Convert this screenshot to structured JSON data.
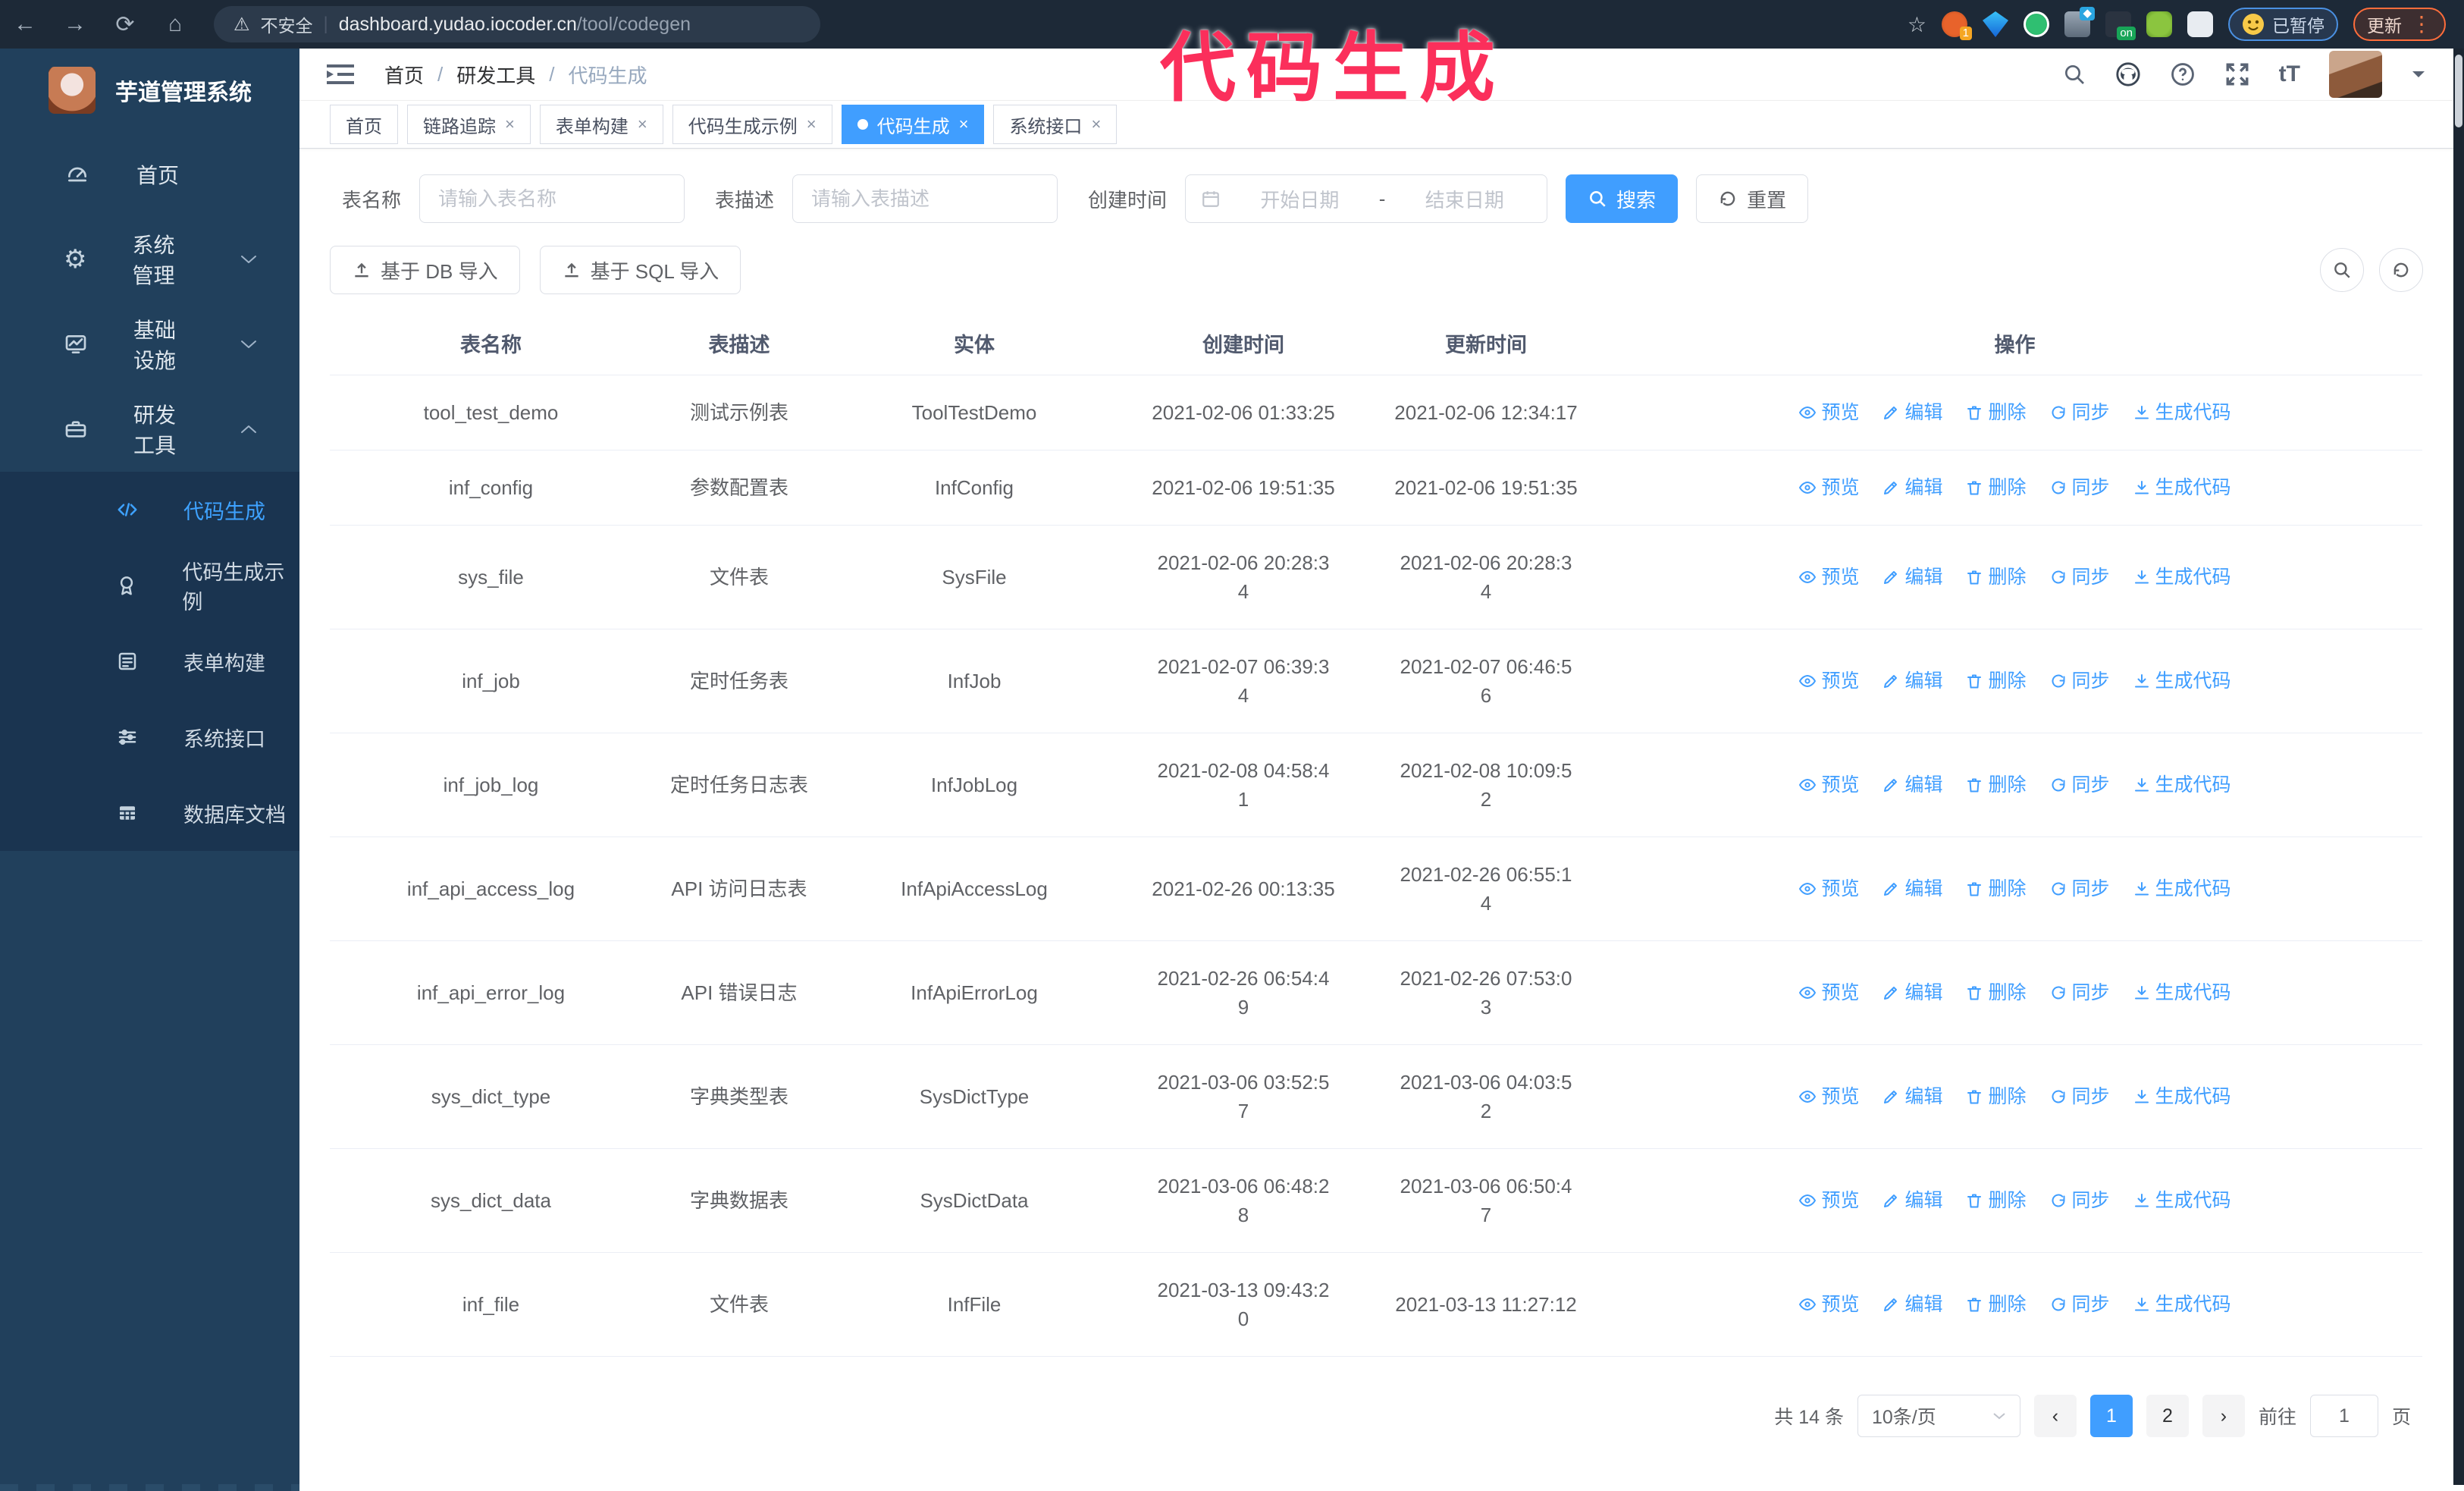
{
  "browser": {
    "security_warning": "不安全",
    "url_host": "dashboard.yudao.iocoder.cn",
    "url_path": "/tool/codegen",
    "paused_badge": "已暂停",
    "update_button": "更新"
  },
  "watermark": "代码生成",
  "colors": {
    "accent": "#409eff",
    "sidebar_bg": "#21405c",
    "submenu_bg": "#1a3450",
    "watermark_pink": "#fb2f5b"
  },
  "sidebar": {
    "title": "芋道管理系统",
    "items": [
      {
        "label": "首页",
        "icon": "dashboard-icon",
        "chevron": ""
      },
      {
        "label": "系统管理",
        "icon": "gear-icon",
        "chevron": "down"
      },
      {
        "label": "基础设施",
        "icon": "monitor-icon",
        "chevron": "down"
      },
      {
        "label": "研发工具",
        "icon": "toolbox-icon",
        "chevron": "up"
      }
    ],
    "submenu": [
      {
        "label": "代码生成",
        "icon": "code-icon",
        "active": true
      },
      {
        "label": "代码生成示例",
        "icon": "example-icon",
        "active": false
      },
      {
        "label": "表单构建",
        "icon": "form-icon",
        "active": false
      },
      {
        "label": "系统接口",
        "icon": "api-icon",
        "active": false
      },
      {
        "label": "数据库文档",
        "icon": "database-icon",
        "active": false
      }
    ]
  },
  "header": {
    "breadcrumb": [
      "首页",
      "研发工具",
      "代码生成"
    ]
  },
  "tabs": [
    {
      "label": "首页",
      "closable": false,
      "active": false
    },
    {
      "label": "链路追踪",
      "closable": true,
      "active": false
    },
    {
      "label": "表单构建",
      "closable": true,
      "active": false
    },
    {
      "label": "代码生成示例",
      "closable": true,
      "active": false
    },
    {
      "label": "代码生成",
      "closable": true,
      "active": true
    },
    {
      "label": "系统接口",
      "closable": true,
      "active": false
    }
  ],
  "filters": {
    "name_label": "表名称",
    "name_placeholder": "请输入表名称",
    "desc_label": "表描述",
    "desc_placeholder": "请输入表描述",
    "time_label": "创建时间",
    "start_placeholder": "开始日期",
    "range_separator": "-",
    "end_placeholder": "结束日期",
    "search_label": "搜索",
    "reset_label": "重置"
  },
  "toolbar": {
    "import_db_label": "基于 DB 导入",
    "import_sql_label": "基于 SQL 导入"
  },
  "table": {
    "columns": [
      "表名称",
      "表描述",
      "实体",
      "创建时间",
      "更新时间",
      "操作"
    ],
    "actions": [
      {
        "label": "预览",
        "icon": "eye-icon"
      },
      {
        "label": "编辑",
        "icon": "edit-icon"
      },
      {
        "label": "删除",
        "icon": "delete-icon"
      },
      {
        "label": "同步",
        "icon": "sync-icon"
      },
      {
        "label": "生成代码",
        "icon": "download-icon"
      }
    ],
    "rows": [
      {
        "name": "tool_test_demo",
        "desc": "测试示例表",
        "entity": "ToolTestDemo",
        "created": "2021-02-06 01:33:25",
        "updated": "2021-02-06 12:34:17"
      },
      {
        "name": "inf_config",
        "desc": "参数配置表",
        "entity": "InfConfig",
        "created": "2021-02-06 19:51:35",
        "updated": "2021-02-06 19:51:35"
      },
      {
        "name": "sys_file",
        "desc": "文件表",
        "entity": "SysFile",
        "created": "2021-02-06 20:28:3\n4",
        "updated": "2021-02-06 20:28:3\n4"
      },
      {
        "name": "inf_job",
        "desc": "定时任务表",
        "entity": "InfJob",
        "created": "2021-02-07 06:39:3\n4",
        "updated": "2021-02-07 06:46:5\n6"
      },
      {
        "name": "inf_job_log",
        "desc": "定时任务日志表",
        "entity": "InfJobLog",
        "created": "2021-02-08 04:58:4\n1",
        "updated": "2021-02-08 10:09:5\n2"
      },
      {
        "name": "inf_api_access_log",
        "desc": "API 访问日志表",
        "entity": "InfApiAccessLog",
        "created": "2021-02-26 00:13:35",
        "updated": "2021-02-26 06:55:1\n4"
      },
      {
        "name": "inf_api_error_log",
        "desc": "API 错误日志",
        "entity": "InfApiErrorLog",
        "created": "2021-02-26 06:54:4\n9",
        "updated": "2021-02-26 07:53:0\n3"
      },
      {
        "name": "sys_dict_type",
        "desc": "字典类型表",
        "entity": "SysDictType",
        "created": "2021-03-06 03:52:5\n7",
        "updated": "2021-03-06 04:03:5\n2"
      },
      {
        "name": "sys_dict_data",
        "desc": "字典数据表",
        "entity": "SysDictData",
        "created": "2021-03-06 06:48:2\n8",
        "updated": "2021-03-06 06:50:4\n7"
      },
      {
        "name": "inf_file",
        "desc": "文件表",
        "entity": "InfFile",
        "created": "2021-03-13 09:43:2\n0",
        "updated": "2021-03-13 11:27:12"
      }
    ]
  },
  "pagination": {
    "total": "共 14 条",
    "page_size": "10条/页",
    "pages": [
      "1",
      "2"
    ],
    "active_page": "1",
    "goto_label": "前往",
    "goto_value": "1",
    "page_label": "页"
  }
}
